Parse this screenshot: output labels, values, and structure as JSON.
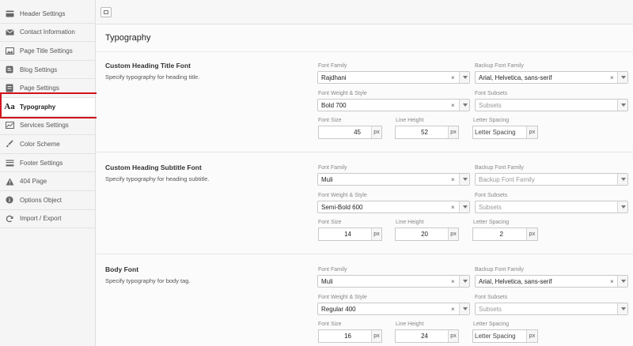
{
  "sidebar": {
    "items": [
      {
        "label": "Header Settings",
        "icon": "credit-card-icon"
      },
      {
        "label": "Contact Information",
        "icon": "envelope-icon"
      },
      {
        "label": "Page Title Settings",
        "icon": "image-icon"
      },
      {
        "label": "Blog Settings",
        "icon": "blog-icon"
      },
      {
        "label": "Page Settings",
        "icon": "page-icon"
      },
      {
        "label": "Typography",
        "icon": "Aa"
      },
      {
        "label": "Services Settings",
        "icon": "chart-icon"
      },
      {
        "label": "Color Scheme",
        "icon": "brush-icon"
      },
      {
        "label": "Footer Settings",
        "icon": "footer-icon"
      },
      {
        "label": "404 Page",
        "icon": "warning-icon"
      },
      {
        "label": "Options Object",
        "icon": "info-icon"
      },
      {
        "label": "Import / Export",
        "icon": "refresh-icon"
      }
    ],
    "active": "Typography",
    "highlight_color": "#d2121b"
  },
  "page": {
    "title": "Typography"
  },
  "labels": {
    "font_family": "Font Family",
    "backup_font_family": "Backup Font Family",
    "font_weight_style": "Font Weight & Style",
    "font_subsets": "Font Subsets",
    "font_size": "Font Size",
    "line_height": "Line Height",
    "letter_spacing": "Letter Spacing",
    "unit": "px"
  },
  "sections": [
    {
      "title": "Custom Heading Title Font",
      "description": "Specify typography for heading title.",
      "font_family": "Rajdhani",
      "backup_font_family": "Arial, Helvetica, sans-serif",
      "font_weight": "Bold 700",
      "subsets_placeholder": "Subsets",
      "font_size": "45",
      "line_height": "52",
      "letter_spacing": "",
      "letter_spacing_placeholder": "Letter Spacing"
    },
    {
      "title": "Custom Heading Subtitle Font",
      "description": "Specify typography for heading subtitle.",
      "font_family": "Muli",
      "backup_font_family": "",
      "backup_placeholder": "Backup Font Family",
      "font_weight": "Semi-Bold 600",
      "subsets_placeholder": "Subsets",
      "font_size": "14",
      "line_height": "20",
      "letter_spacing": "2"
    },
    {
      "title": "Body Font",
      "description": "Specify typography for body tag.",
      "font_family": "Muli",
      "backup_font_family": "Arial, Helvetica, sans-serif",
      "font_weight": "Regular 400",
      "subsets_placeholder": "Subsets",
      "font_size": "16",
      "line_height": "24",
      "letter_spacing": "",
      "letter_spacing_placeholder": "Letter Spacing"
    }
  ]
}
